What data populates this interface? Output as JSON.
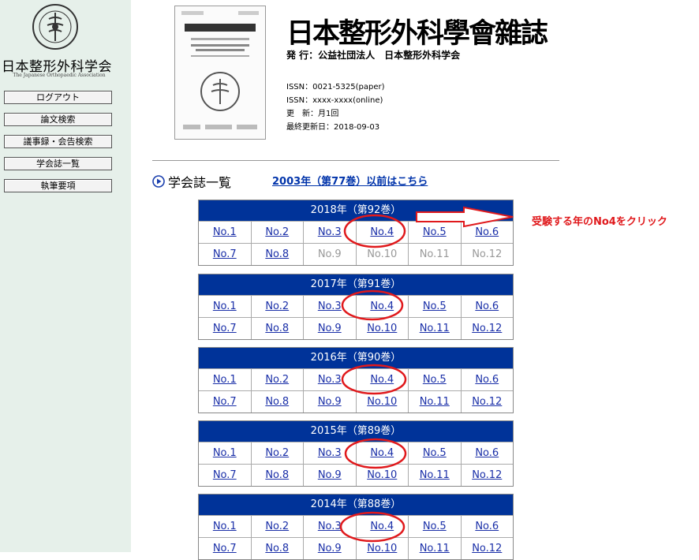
{
  "sidebar": {
    "logo_title": "日本整形外科学会",
    "logo_subtitle": "The Japanese Orthopaedic Association",
    "menu": [
      "ログアウト",
      "論文検索",
      "議事録・会告検索",
      "学会誌一覧",
      "執筆要項"
    ]
  },
  "journal": {
    "title": "日本整形外科學會雜誌",
    "publisher": "発 行：公益社団法人　日本整形外科学会",
    "issn_paper": "ISSN：0021-5325(paper)",
    "issn_online": "ISSN：xxxx-xxxx(online)",
    "frequency": "更　新：月1回",
    "last_updated": "最終更新日：2018-09-03"
  },
  "section": {
    "title": "学会誌一覧",
    "old_link": "2003年（第77巻）以前はこちら"
  },
  "volumes": [
    {
      "header": "2018年（第92巻）",
      "issues": [
        {
          "label": "No.1",
          "available": true
        },
        {
          "label": "No.2",
          "available": true
        },
        {
          "label": "No.3",
          "available": true
        },
        {
          "label": "No.4",
          "available": true
        },
        {
          "label": "No.5",
          "available": true
        },
        {
          "label": "No.6",
          "available": true
        },
        {
          "label": "No.7",
          "available": true
        },
        {
          "label": "No.8",
          "available": true
        },
        {
          "label": "No.9",
          "available": false
        },
        {
          "label": "No.10",
          "available": false
        },
        {
          "label": "No.11",
          "available": false
        },
        {
          "label": "No.12",
          "available": false
        }
      ]
    },
    {
      "header": "2017年（第91巻）",
      "issues": [
        {
          "label": "No.1",
          "available": true
        },
        {
          "label": "No.2",
          "available": true
        },
        {
          "label": "No.3",
          "available": true
        },
        {
          "label": "No.4",
          "available": true
        },
        {
          "label": "No.5",
          "available": true
        },
        {
          "label": "No.6",
          "available": true
        },
        {
          "label": "No.7",
          "available": true
        },
        {
          "label": "No.8",
          "available": true
        },
        {
          "label": "No.9",
          "available": true
        },
        {
          "label": "No.10",
          "available": true
        },
        {
          "label": "No.11",
          "available": true
        },
        {
          "label": "No.12",
          "available": true
        }
      ]
    },
    {
      "header": "2016年（第90巻）",
      "issues": [
        {
          "label": "No.1",
          "available": true
        },
        {
          "label": "No.2",
          "available": true
        },
        {
          "label": "No.3",
          "available": true
        },
        {
          "label": "No.4",
          "available": true
        },
        {
          "label": "No.5",
          "available": true
        },
        {
          "label": "No.6",
          "available": true
        },
        {
          "label": "No.7",
          "available": true
        },
        {
          "label": "No.8",
          "available": true
        },
        {
          "label": "No.9",
          "available": true
        },
        {
          "label": "No.10",
          "available": true
        },
        {
          "label": "No.11",
          "available": true
        },
        {
          "label": "No.12",
          "available": true
        }
      ]
    },
    {
      "header": "2015年（第89巻）",
      "issues": [
        {
          "label": "No.1",
          "available": true
        },
        {
          "label": "No.2",
          "available": true
        },
        {
          "label": "No.3",
          "available": true
        },
        {
          "label": "No.4",
          "available": true
        },
        {
          "label": "No.5",
          "available": true
        },
        {
          "label": "No.6",
          "available": true
        },
        {
          "label": "No.7",
          "available": true
        },
        {
          "label": "No.8",
          "available": true
        },
        {
          "label": "No.9",
          "available": true
        },
        {
          "label": "No.10",
          "available": true
        },
        {
          "label": "No.11",
          "available": true
        },
        {
          "label": "No.12",
          "available": true
        }
      ]
    },
    {
      "header": "2014年（第88巻）",
      "issues": [
        {
          "label": "No.1",
          "available": true
        },
        {
          "label": "No.2",
          "available": true
        },
        {
          "label": "No.3",
          "available": true
        },
        {
          "label": "No.4",
          "available": true
        },
        {
          "label": "No.5",
          "available": true
        },
        {
          "label": "No.6",
          "available": true
        },
        {
          "label": "No.7",
          "available": true
        },
        {
          "label": "No.8",
          "available": true
        },
        {
          "label": "No.9",
          "available": true
        },
        {
          "label": "No.10",
          "available": true
        },
        {
          "label": "No.11",
          "available": true
        },
        {
          "label": "No.12",
          "available": true
        }
      ]
    }
  ],
  "annotation": {
    "text": "受験する年のNo4をクリック",
    "color": "#e0191c"
  },
  "colors": {
    "sidebar_bg": "#e6f0ea",
    "volume_header_bg": "#003399",
    "link": "#1a2fa8"
  }
}
